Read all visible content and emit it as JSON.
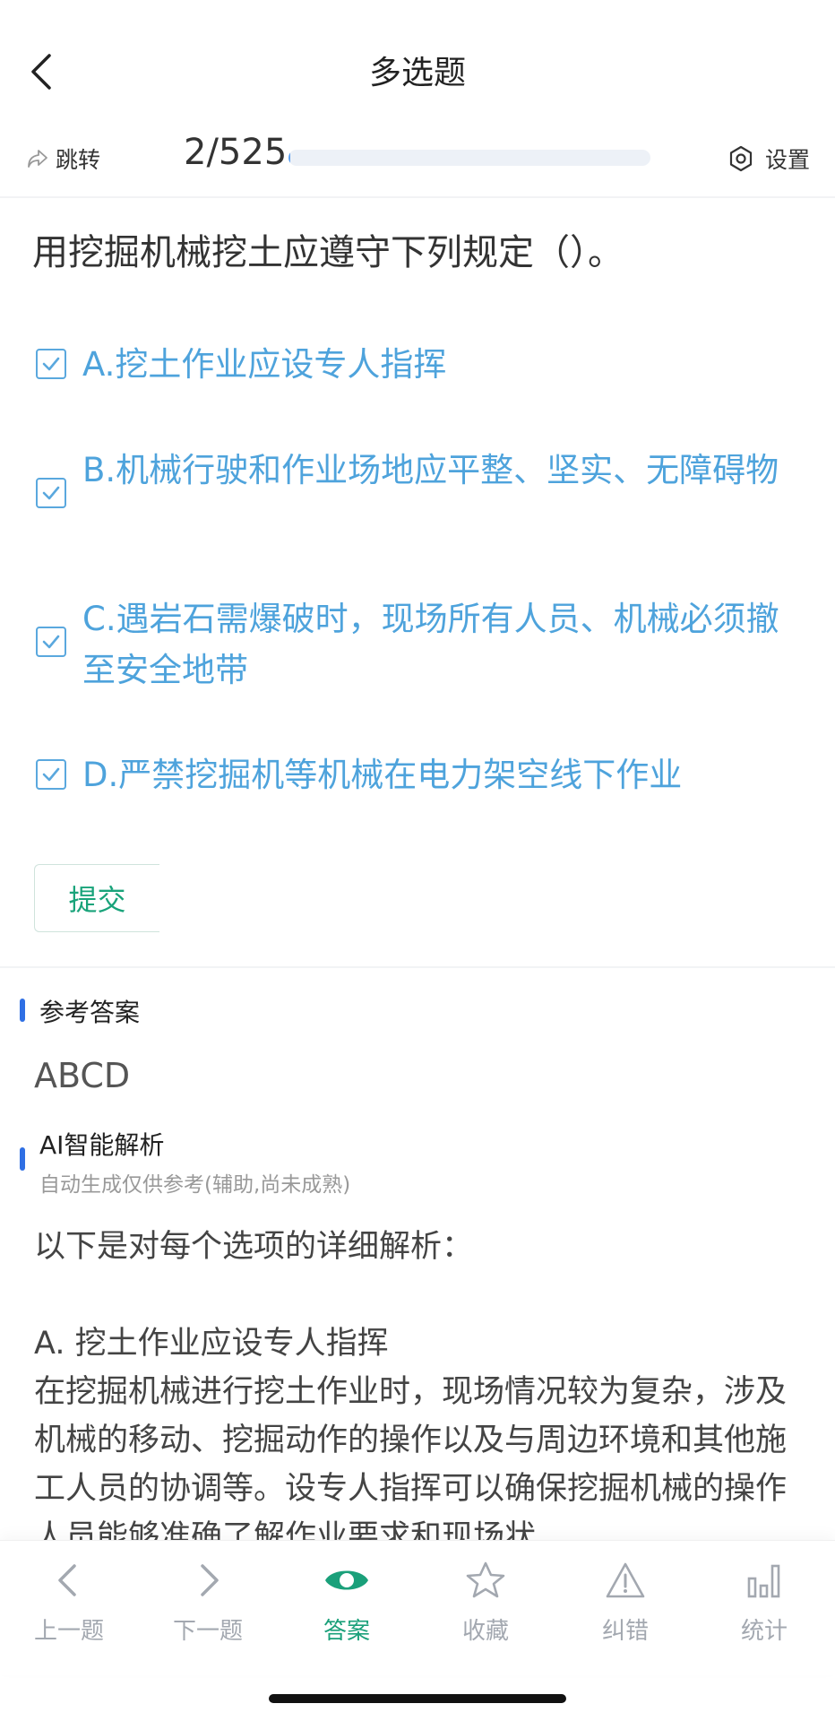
{
  "header": {
    "title": "多选题"
  },
  "progress": {
    "jump_label": "跳转",
    "current": 2,
    "total": 525,
    "text": "2/525",
    "settings_label": "设置"
  },
  "question": {
    "text": "用挖掘机械挖土应遵守下列规定（）。",
    "options": [
      {
        "label": "A.挖土作业应设专人指挥",
        "checked": true
      },
      {
        "label": "B.机械行驶和作业场地应平整、坚实、无障碍物",
        "checked": true
      },
      {
        "label": "C.遇岩石需爆破时，现场所有人员、机械必须撤至安全地带",
        "checked": true
      },
      {
        "label": "D.严禁挖掘机等机械在电力架空线下作业",
        "checked": true
      }
    ],
    "submit_label": "提交"
  },
  "answer": {
    "title": "参考答案",
    "value": "ABCD"
  },
  "ai": {
    "title": "AI智能解析",
    "subtitle": "自动生成仅供参考(辅助,尚未成熟)",
    "intro": "以下是对每个选项的详细解析：",
    "heading_a": "A. 挖土作业应设专人指挥",
    "body_a": "在挖掘机械进行挖土作业时，现场情况较为复杂，涉及机械的移动、挖掘动作的操作以及与周边环境和其他施工人员的协调等。设专人指挥可以确保挖掘机械的操作人员能够准确了解作业要求和现场状"
  },
  "tabbar": {
    "items": [
      {
        "label": "上一题",
        "icon": "chevron-left-icon"
      },
      {
        "label": "下一题",
        "icon": "chevron-right-icon"
      },
      {
        "label": "答案",
        "icon": "eye-icon",
        "active": true
      },
      {
        "label": "收藏",
        "icon": "star-icon"
      },
      {
        "label": "纠错",
        "icon": "warning-icon"
      },
      {
        "label": "统计",
        "icon": "bar-chart-icon"
      }
    ]
  },
  "colors": {
    "accent": "#1aa07a",
    "option": "#4ea3dc",
    "section_bar": "#2f6fe4"
  }
}
